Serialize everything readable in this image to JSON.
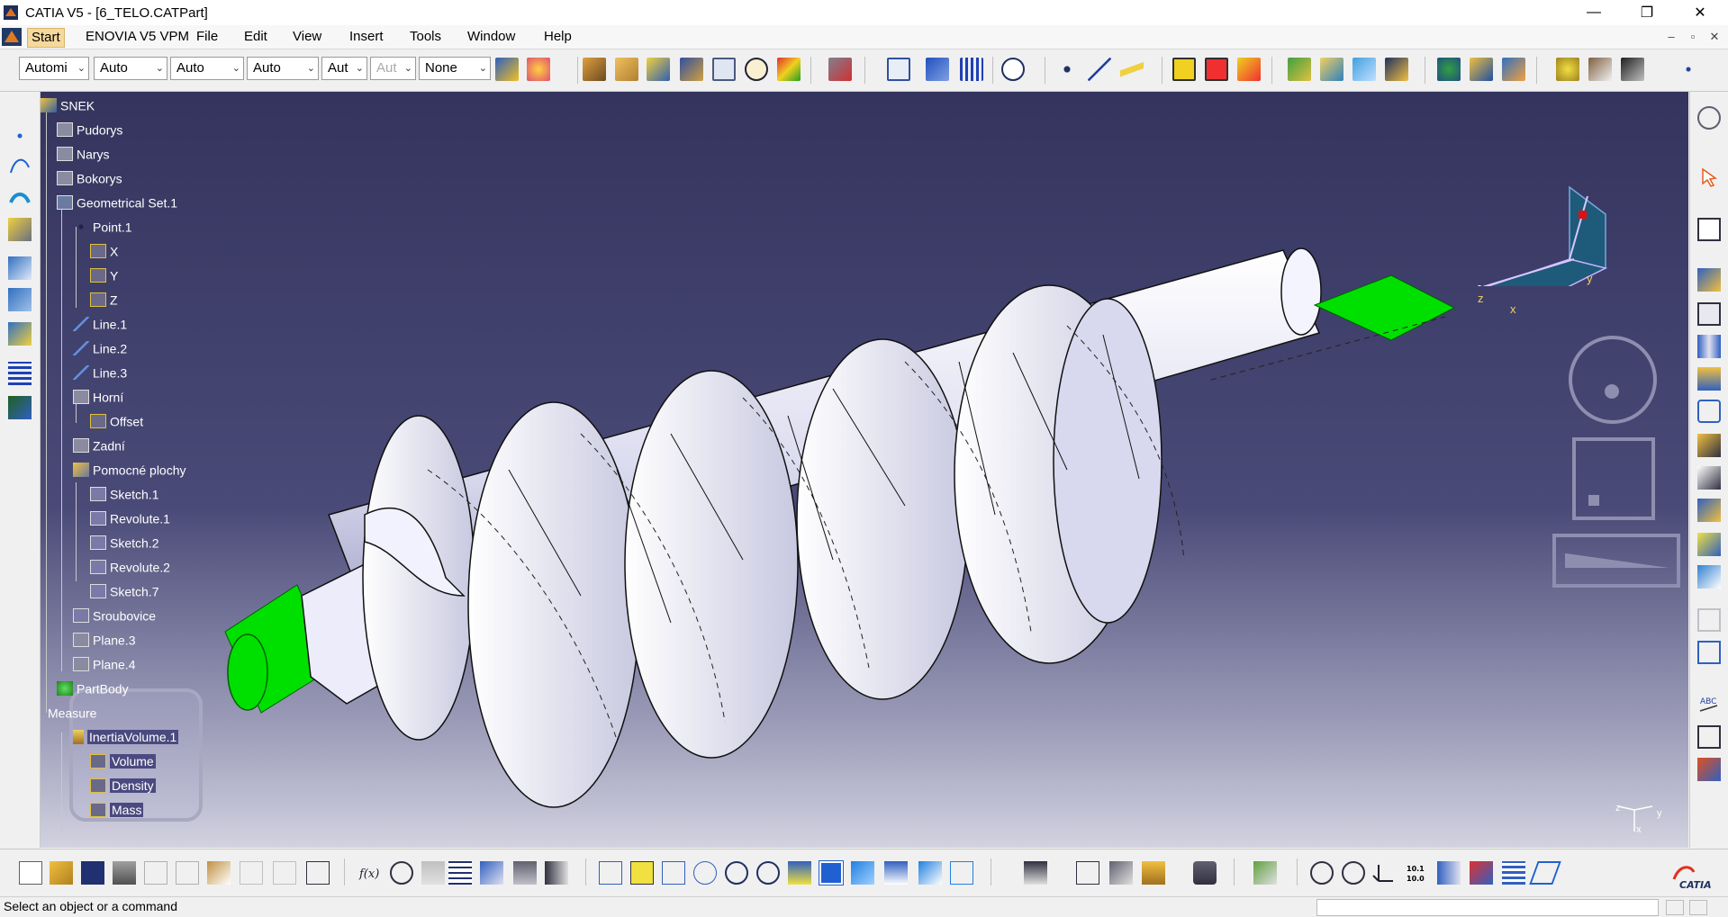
{
  "window": {
    "title": "CATIA V5 - [6_TELO.CATPart]",
    "minimize_glyph": "—",
    "restore_glyph": "❐",
    "close_glyph": "✕"
  },
  "menubar": {
    "items": [
      "Start",
      "ENOVIA V5 VPM",
      "File",
      "Edit",
      "View",
      "Insert",
      "Tools",
      "Window",
      "Help"
    ],
    "doc_minimize": "–",
    "doc_restore": "▫",
    "doc_close": "✕"
  },
  "toolbar": {
    "combos": [
      {
        "value": "Automi",
        "disabled": false
      },
      {
        "value": "Auto",
        "disabled": false
      },
      {
        "value": "Auto",
        "disabled": false
      },
      {
        "value": "Auto",
        "disabled": false
      },
      {
        "value": "Aut",
        "disabled": false
      },
      {
        "value": "Aut",
        "disabled": true
      },
      {
        "value": "None",
        "disabled": false
      }
    ],
    "combo_arrow": "⌄"
  },
  "tree": {
    "nodes": [
      {
        "label": "SNEK",
        "icon": "part-icon"
      },
      {
        "label": "Pudorys",
        "icon": "plane-icon"
      },
      {
        "label": "Narys",
        "icon": "plane-icon"
      },
      {
        "label": "Bokorys",
        "icon": "plane-icon"
      },
      {
        "label": "Geometrical Set.1",
        "icon": "geometrical-set-icon"
      },
      {
        "label": "Point.1",
        "icon": "point-icon"
      },
      {
        "label": "X",
        "icon": "parameter-icon"
      },
      {
        "label": "Y",
        "icon": "parameter-icon"
      },
      {
        "label": "Z",
        "icon": "parameter-icon"
      },
      {
        "label": "Line.1",
        "icon": "line-icon"
      },
      {
        "label": "Line.2",
        "icon": "line-icon"
      },
      {
        "label": "Line.3",
        "icon": "line-icon"
      },
      {
        "label": "Horní",
        "icon": "plane-icon"
      },
      {
        "label": "Offset",
        "icon": "parameter-icon"
      },
      {
        "label": "Zadní",
        "icon": "plane-icon"
      },
      {
        "label": "Pomocné plochy",
        "icon": "geometrical-set-icon"
      },
      {
        "label": "Sketch.1",
        "icon": "sketch-icon"
      },
      {
        "label": "Revolute.1",
        "icon": "revolute-icon"
      },
      {
        "label": "Sketch.2",
        "icon": "sketch-icon"
      },
      {
        "label": "Revolute.2",
        "icon": "revolute-icon"
      },
      {
        "label": "Sketch.7",
        "icon": "sketch-icon"
      },
      {
        "label": "Sroubovice",
        "icon": "helix-icon"
      },
      {
        "label": "Plane.3",
        "icon": "plane-icon"
      },
      {
        "label": "Plane.4",
        "icon": "plane-icon"
      },
      {
        "label": "PartBody",
        "icon": "body-icon"
      },
      {
        "label": "Measure",
        "icon": "measure-icon"
      },
      {
        "label": "InertiaVolume.1",
        "icon": "inertia-icon"
      },
      {
        "label": "Volume",
        "icon": "parameter-icon"
      },
      {
        "label": "Density",
        "icon": "parameter-icon"
      },
      {
        "label": "Mass",
        "icon": "parameter-icon"
      }
    ]
  },
  "viewport": {
    "compass_labels": {
      "x": "x",
      "y": "y",
      "z": "z"
    },
    "axis_labels": {
      "x": "x",
      "y": "y",
      "z": "z"
    },
    "highlight_color": "#00e000",
    "background_top": "#34345e",
    "background_bottom": "#d2d2e0"
  },
  "statusbar": {
    "message": "Select an object or a command"
  },
  "brand": {
    "logo_text": "CATIA"
  }
}
